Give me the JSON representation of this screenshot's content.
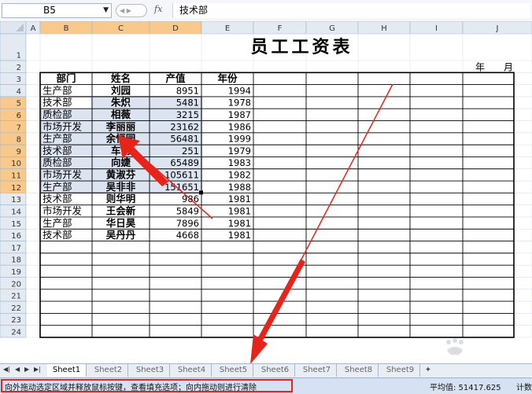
{
  "formula_bar": {
    "name_box": "B5",
    "formula": "技术部"
  },
  "columns": [
    "A",
    "B",
    "C",
    "D",
    "E",
    "F",
    "G",
    "H",
    "I",
    "J"
  ],
  "title": "员工工资表",
  "year_label": "年",
  "month_label": "月",
  "table": {
    "headers": [
      "部门",
      "姓名",
      "产值",
      "年份"
    ],
    "rows": [
      [
        "生产部",
        "刘园",
        "8951",
        "1994"
      ],
      [
        "技术部",
        "朱炽",
        "5481",
        "1978"
      ],
      [
        "质检部",
        "相薇",
        "3215",
        "1987"
      ],
      [
        "市场开发",
        "李丽丽",
        "23162",
        "1986"
      ],
      [
        "生产部",
        "余恒园",
        "56481",
        "1999"
      ],
      [
        "技术部",
        "车前",
        "251",
        "1979"
      ],
      [
        "质检部",
        "向婕",
        "65489",
        "1983"
      ],
      [
        "市场开发",
        "黄淑芬",
        "105611",
        "1982"
      ],
      [
        "生产部",
        "吴非非",
        "151651",
        "1988"
      ],
      [
        "技术部",
        "则华明",
        "986",
        "1981"
      ],
      [
        "市场开发",
        "王会新",
        "5849",
        "1981"
      ],
      [
        "生产部",
        "华日昊",
        "7896",
        "1981"
      ],
      [
        "技术部",
        "吴丹丹",
        "4668",
        "1981"
      ]
    ]
  },
  "sheet_tabs": [
    "Sheet1",
    "Sheet2",
    "Sheet3",
    "Sheet4",
    "Sheet5",
    "Sheet6",
    "Sheet7",
    "Sheet8",
    "Sheet9"
  ],
  "status": {
    "message": "向外拖动选定区域并释放鼠标按键，查看填充选项；向内拖动则进行清除",
    "average": "平均值: 51417.625",
    "count": "计数"
  },
  "colors": {
    "selection_fill": "#dde4f1",
    "selected_header": "#f8c98a",
    "arrow": "#e8231a"
  }
}
